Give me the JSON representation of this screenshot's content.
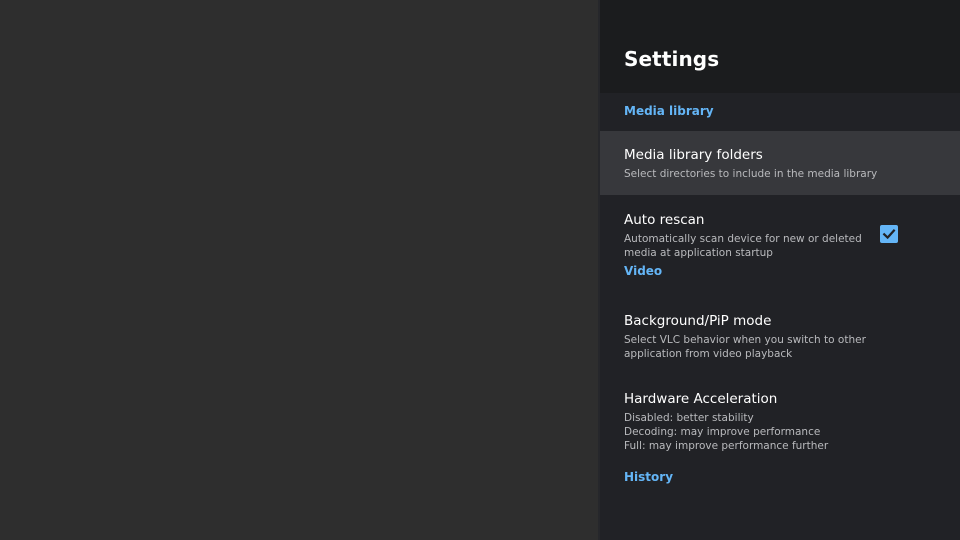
{
  "settings": {
    "title": "Settings",
    "sections": {
      "media_library": "Media library",
      "video": "Video",
      "history": "History"
    },
    "items": {
      "folders": {
        "title": "Media library folders",
        "summary": "Select directories to include in the media library"
      },
      "rescan": {
        "title": "Auto rescan",
        "summary": "Automatically scan device for new or deleted media at application startup",
        "checked": true
      },
      "pip": {
        "title": "Background/PiP mode",
        "summary": "Select VLC behavior when you switch to other application from video playback"
      },
      "hw": {
        "title": "Hardware Acceleration",
        "summary": "Disabled: better stability\nDecoding: may improve performance\nFull: may improve performance further"
      }
    }
  },
  "colors": {
    "accent": "#64b5f6",
    "panel_bg": "#212226",
    "header_bg": "#1b1c1e",
    "focused_bg": "#37383c",
    "backdrop": "#2e2e2e"
  },
  "icons": {
    "checkbox": "checkbox-checked-icon"
  }
}
